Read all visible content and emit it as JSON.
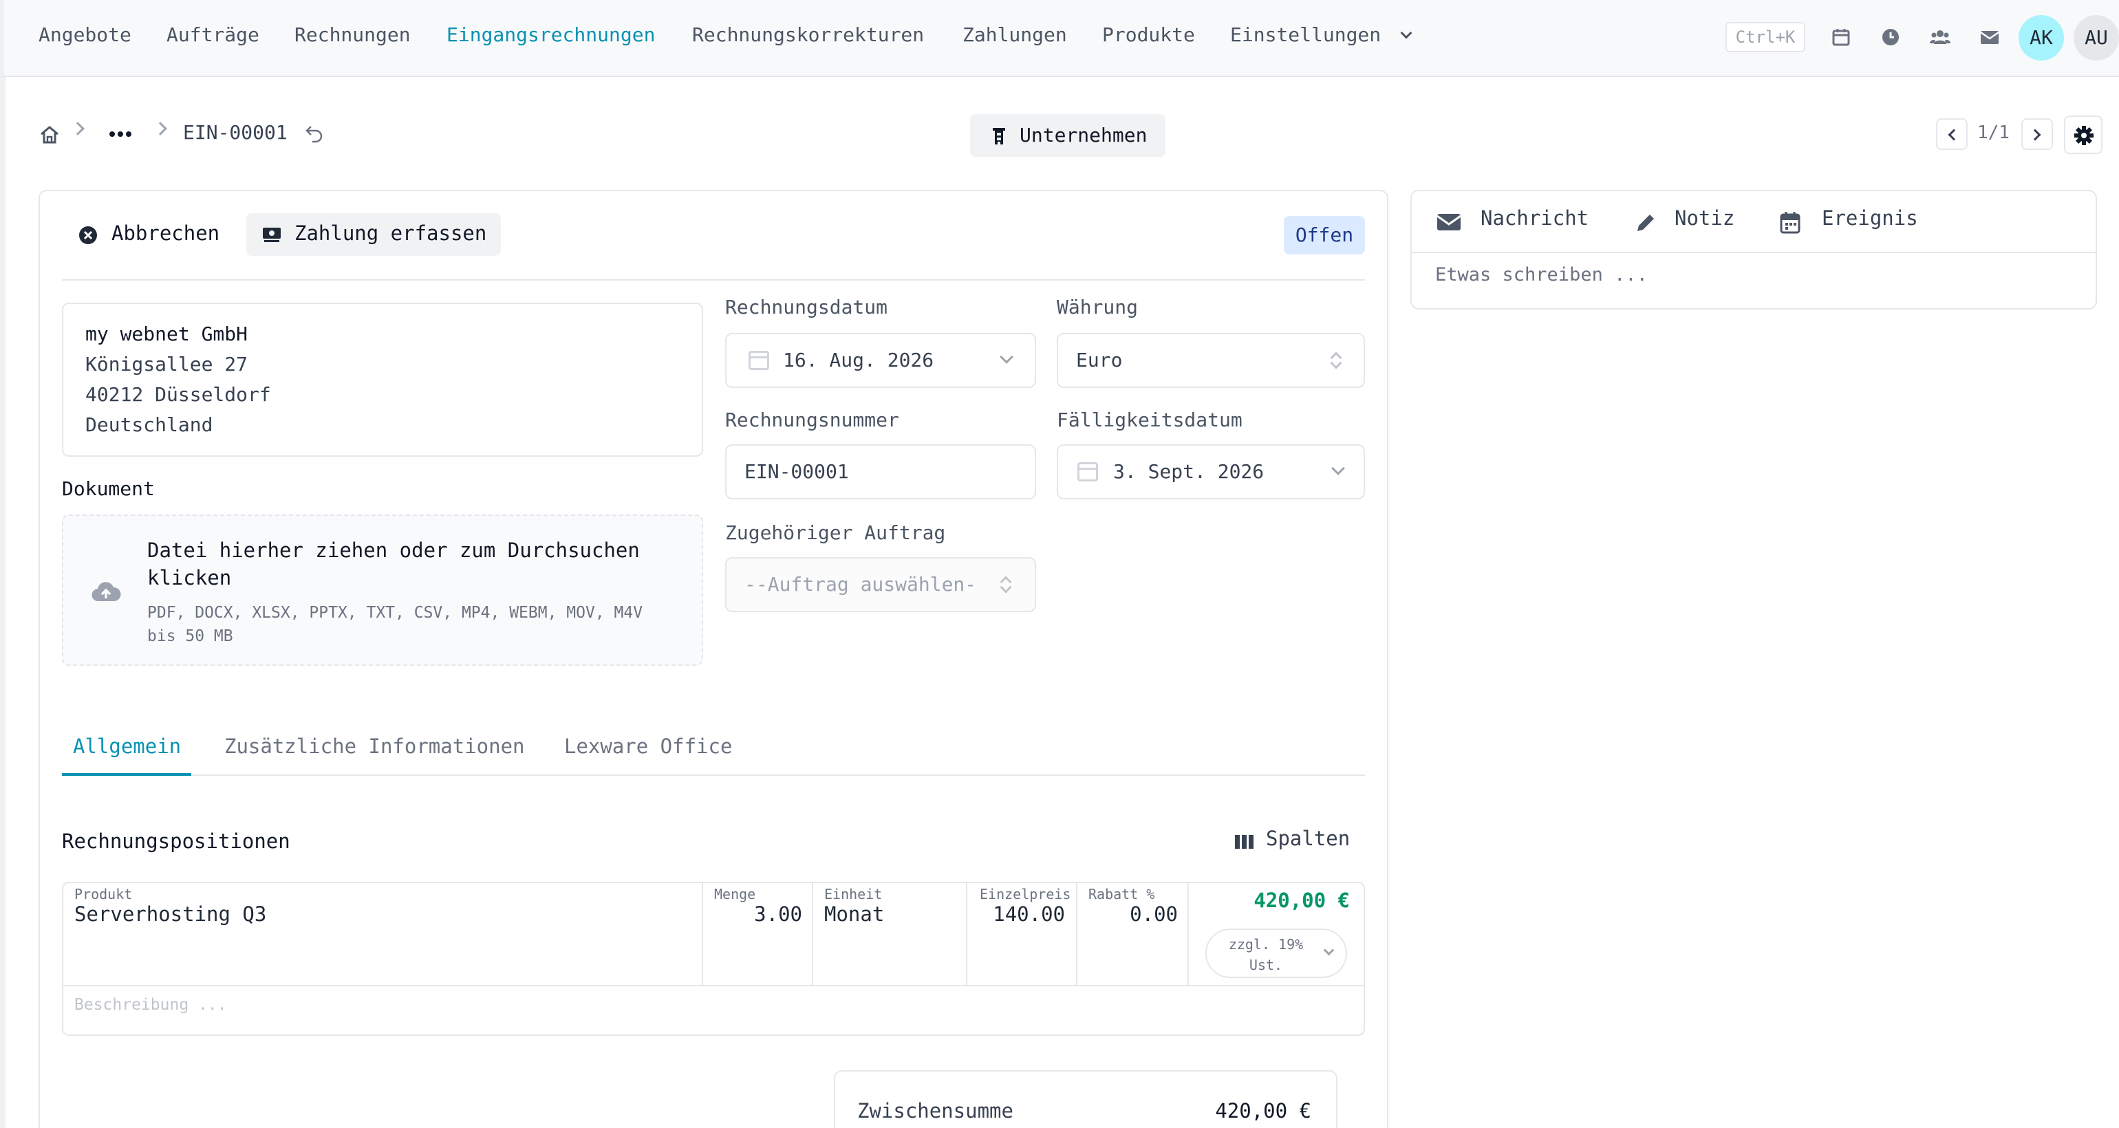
{
  "nav": {
    "items": [
      "Angebote",
      "Aufträge",
      "Rechnungen",
      "Eingangsrechnungen",
      "Rechnungskorrekturen",
      "Zahlungen",
      "Produkte",
      "Einstellungen"
    ],
    "active": "Eingangsrechnungen",
    "shortcut": "Ctrl+K",
    "avatars": [
      "AK",
      "AU"
    ],
    "icons": [
      "calendar-icon",
      "clock-icon",
      "team-icon",
      "mail-icon"
    ]
  },
  "breadcrumb": {
    "current": "EIN-00001"
  },
  "header": {
    "company_button": "Unternehmen",
    "pager": "1/1"
  },
  "toolbar": {
    "cancel_label": "Abbrechen",
    "payment_label": "Zahlung erfassen",
    "status": "Offen"
  },
  "address": {
    "lines": [
      "my webnet GmbH",
      "Königsallee 27",
      "40212 Düsseldorf",
      "Deutschland"
    ]
  },
  "document": {
    "label": "Dokument",
    "drop_title": "Datei hierher ziehen oder zum Durchsuchen klicken",
    "drop_hint": "PDF, DOCX, XLSX, PPTX, TXT, CSV, MP4, WEBM, MOV, M4V bis 50 MB"
  },
  "fields": {
    "invoice_date_label": "Rechnungsdatum",
    "invoice_date": "16. Aug. 2026",
    "currency_label": "Währung",
    "currency": "Euro",
    "invoice_number_label": "Rechnungsnummer",
    "invoice_number": "EIN-00001",
    "due_date_label": "Fälligkeitsdatum",
    "due_date": "3. Sept. 2026",
    "order_label": "Zugehöriger Auftrag",
    "order_placeholder": "--Auftrag auswählen-"
  },
  "tabs": [
    "Allgemein",
    "Zusätzliche Informationen",
    "Lexware Office"
  ],
  "positions": {
    "title": "Rechnungspositionen",
    "columns_button": "Spalten",
    "headers": {
      "product": "Produkt",
      "qty": "Menge",
      "unit": "Einheit",
      "price": "Einzelpreis",
      "discount": "Rabatt %"
    },
    "row": {
      "product": "Serverhosting Q3",
      "qty": "3.00",
      "unit": "Monat",
      "price": "140.00",
      "discount": "0.00",
      "total": "420,00 €",
      "tax_line1": "zzgl. 19%",
      "tax_line2": "Ust."
    },
    "description_placeholder": "Beschreibung ..."
  },
  "summary": {
    "subtotal_label": "Zwischensumme",
    "subtotal": "420,00 €"
  },
  "side": {
    "tabs": [
      "Nachricht",
      "Notiz",
      "Ereignis"
    ],
    "placeholder": "Etwas schreiben ..."
  },
  "colors": {
    "accent": "#0891b2",
    "total_green": "#059669",
    "status_bg": "#dbeafe",
    "avatar_ak": "#a5f3fc"
  }
}
